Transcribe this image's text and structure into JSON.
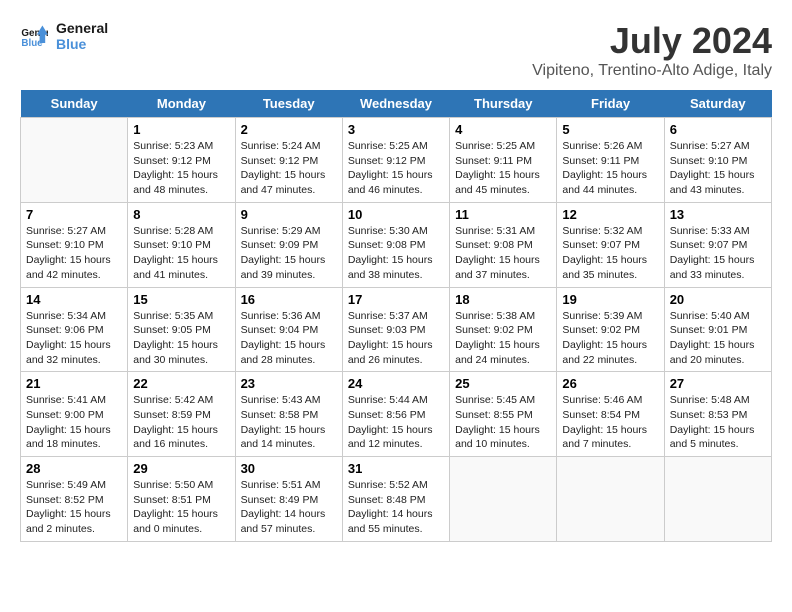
{
  "header": {
    "logo_line1": "General",
    "logo_line2": "Blue",
    "month_year": "July 2024",
    "location": "Vipiteno, Trentino-Alto Adige, Italy"
  },
  "days_of_week": [
    "Sunday",
    "Monday",
    "Tuesday",
    "Wednesday",
    "Thursday",
    "Friday",
    "Saturday"
  ],
  "weeks": [
    [
      {
        "day": "",
        "info": ""
      },
      {
        "day": "1",
        "info": "Sunrise: 5:23 AM\nSunset: 9:12 PM\nDaylight: 15 hours\nand 48 minutes."
      },
      {
        "day": "2",
        "info": "Sunrise: 5:24 AM\nSunset: 9:12 PM\nDaylight: 15 hours\nand 47 minutes."
      },
      {
        "day": "3",
        "info": "Sunrise: 5:25 AM\nSunset: 9:12 PM\nDaylight: 15 hours\nand 46 minutes."
      },
      {
        "day": "4",
        "info": "Sunrise: 5:25 AM\nSunset: 9:11 PM\nDaylight: 15 hours\nand 45 minutes."
      },
      {
        "day": "5",
        "info": "Sunrise: 5:26 AM\nSunset: 9:11 PM\nDaylight: 15 hours\nand 44 minutes."
      },
      {
        "day": "6",
        "info": "Sunrise: 5:27 AM\nSunset: 9:10 PM\nDaylight: 15 hours\nand 43 minutes."
      }
    ],
    [
      {
        "day": "7",
        "info": "Sunrise: 5:27 AM\nSunset: 9:10 PM\nDaylight: 15 hours\nand 42 minutes."
      },
      {
        "day": "8",
        "info": "Sunrise: 5:28 AM\nSunset: 9:10 PM\nDaylight: 15 hours\nand 41 minutes."
      },
      {
        "day": "9",
        "info": "Sunrise: 5:29 AM\nSunset: 9:09 PM\nDaylight: 15 hours\nand 39 minutes."
      },
      {
        "day": "10",
        "info": "Sunrise: 5:30 AM\nSunset: 9:08 PM\nDaylight: 15 hours\nand 38 minutes."
      },
      {
        "day": "11",
        "info": "Sunrise: 5:31 AM\nSunset: 9:08 PM\nDaylight: 15 hours\nand 37 minutes."
      },
      {
        "day": "12",
        "info": "Sunrise: 5:32 AM\nSunset: 9:07 PM\nDaylight: 15 hours\nand 35 minutes."
      },
      {
        "day": "13",
        "info": "Sunrise: 5:33 AM\nSunset: 9:07 PM\nDaylight: 15 hours\nand 33 minutes."
      }
    ],
    [
      {
        "day": "14",
        "info": "Sunrise: 5:34 AM\nSunset: 9:06 PM\nDaylight: 15 hours\nand 32 minutes."
      },
      {
        "day": "15",
        "info": "Sunrise: 5:35 AM\nSunset: 9:05 PM\nDaylight: 15 hours\nand 30 minutes."
      },
      {
        "day": "16",
        "info": "Sunrise: 5:36 AM\nSunset: 9:04 PM\nDaylight: 15 hours\nand 28 minutes."
      },
      {
        "day": "17",
        "info": "Sunrise: 5:37 AM\nSunset: 9:03 PM\nDaylight: 15 hours\nand 26 minutes."
      },
      {
        "day": "18",
        "info": "Sunrise: 5:38 AM\nSunset: 9:02 PM\nDaylight: 15 hours\nand 24 minutes."
      },
      {
        "day": "19",
        "info": "Sunrise: 5:39 AM\nSunset: 9:02 PM\nDaylight: 15 hours\nand 22 minutes."
      },
      {
        "day": "20",
        "info": "Sunrise: 5:40 AM\nSunset: 9:01 PM\nDaylight: 15 hours\nand 20 minutes."
      }
    ],
    [
      {
        "day": "21",
        "info": "Sunrise: 5:41 AM\nSunset: 9:00 PM\nDaylight: 15 hours\nand 18 minutes."
      },
      {
        "day": "22",
        "info": "Sunrise: 5:42 AM\nSunset: 8:59 PM\nDaylight: 15 hours\nand 16 minutes."
      },
      {
        "day": "23",
        "info": "Sunrise: 5:43 AM\nSunset: 8:58 PM\nDaylight: 15 hours\nand 14 minutes."
      },
      {
        "day": "24",
        "info": "Sunrise: 5:44 AM\nSunset: 8:56 PM\nDaylight: 15 hours\nand 12 minutes."
      },
      {
        "day": "25",
        "info": "Sunrise: 5:45 AM\nSunset: 8:55 PM\nDaylight: 15 hours\nand 10 minutes."
      },
      {
        "day": "26",
        "info": "Sunrise: 5:46 AM\nSunset: 8:54 PM\nDaylight: 15 hours\nand 7 minutes."
      },
      {
        "day": "27",
        "info": "Sunrise: 5:48 AM\nSunset: 8:53 PM\nDaylight: 15 hours\nand 5 minutes."
      }
    ],
    [
      {
        "day": "28",
        "info": "Sunrise: 5:49 AM\nSunset: 8:52 PM\nDaylight: 15 hours\nand 2 minutes."
      },
      {
        "day": "29",
        "info": "Sunrise: 5:50 AM\nSunset: 8:51 PM\nDaylight: 15 hours\nand 0 minutes."
      },
      {
        "day": "30",
        "info": "Sunrise: 5:51 AM\nSunset: 8:49 PM\nDaylight: 14 hours\nand 57 minutes."
      },
      {
        "day": "31",
        "info": "Sunrise: 5:52 AM\nSunset: 8:48 PM\nDaylight: 14 hours\nand 55 minutes."
      },
      {
        "day": "",
        "info": ""
      },
      {
        "day": "",
        "info": ""
      },
      {
        "day": "",
        "info": ""
      }
    ]
  ]
}
